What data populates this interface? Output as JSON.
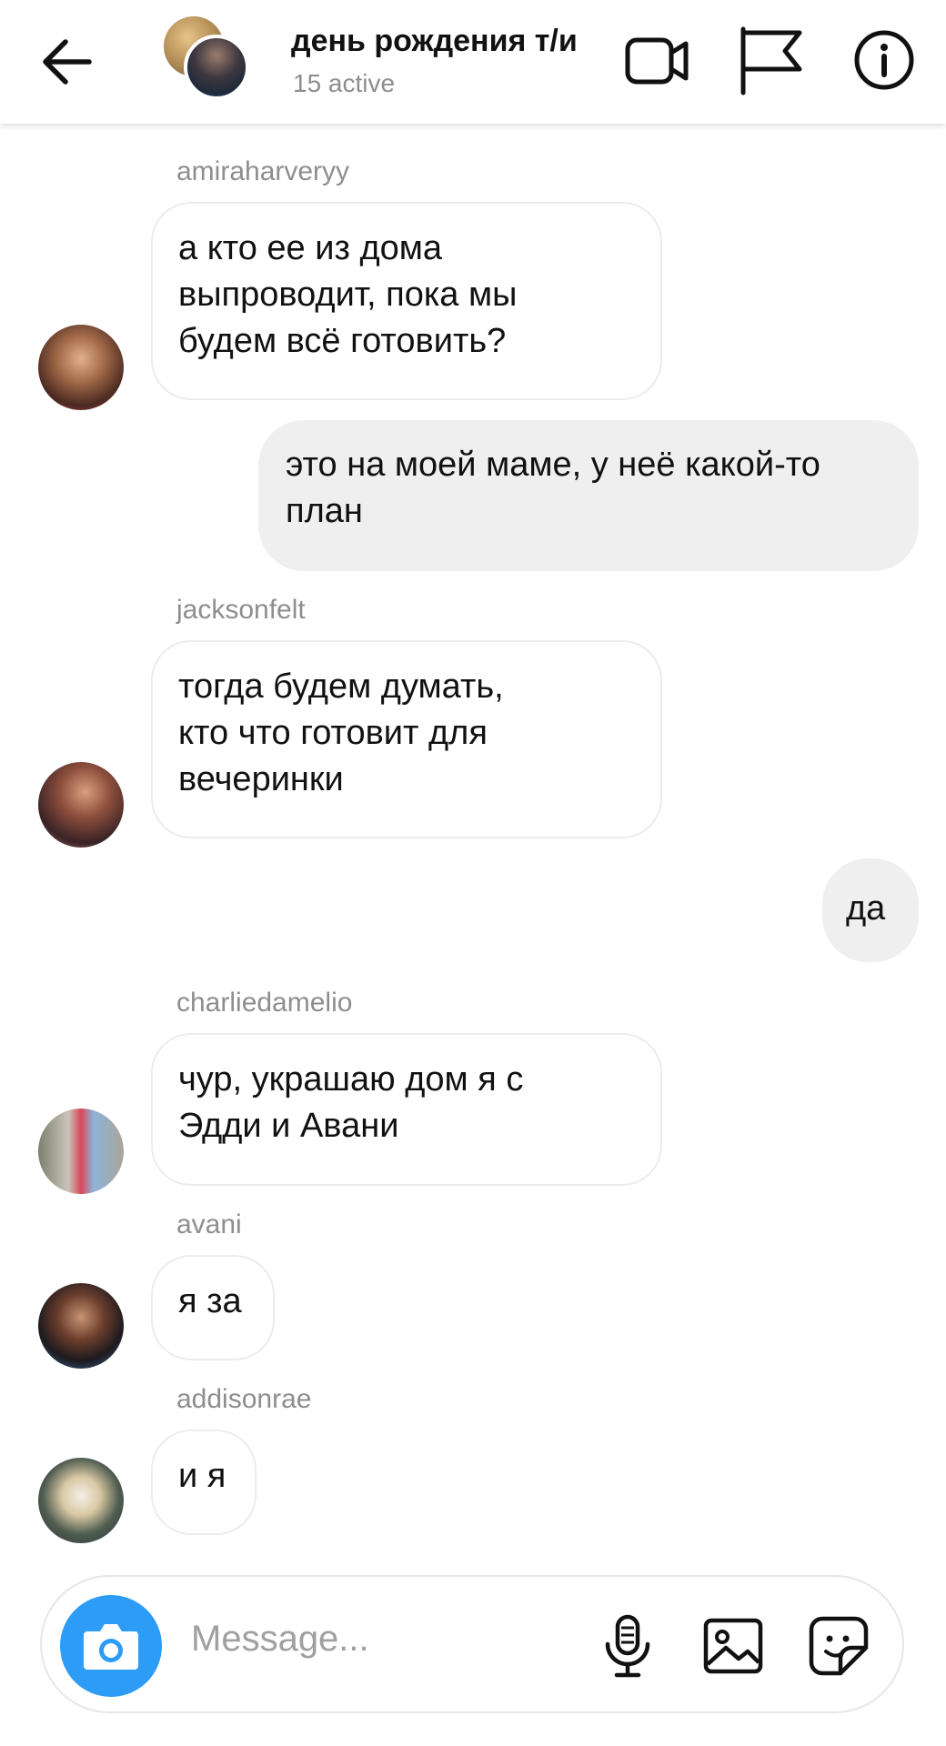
{
  "header": {
    "title": "день рождения т/и",
    "subtitle": "15 active"
  },
  "messages": [
    {
      "sender": "amiraharveryy",
      "lines": [
        "а кто ее из дома",
        "выпроводит, пока мы",
        "будем всё готовить?"
      ]
    },
    {
      "outgoing": true,
      "lines": [
        "это на моей маме, у неё какой-то",
        "план"
      ]
    },
    {
      "sender": "jacksonfelt",
      "lines": [
        "тогда будем думать,",
        "кто что готовит для",
        "вечеринки"
      ]
    },
    {
      "outgoing": true,
      "lines": [
        "да"
      ]
    },
    {
      "sender": "charliedamelio",
      "lines": [
        "чур, украшаю дом я с",
        "Эдди и Авани"
      ]
    },
    {
      "sender": "avani",
      "lines": [
        "я за"
      ]
    },
    {
      "sender": "addisonrae",
      "lines": [
        "и я"
      ]
    }
  ],
  "composer": {
    "placeholder": "Message..."
  },
  "icons": {
    "back": "arrow-left-icon",
    "video": "video-camera-icon",
    "flag": "flag-icon",
    "info": "info-icon",
    "camera": "camera-icon",
    "mic": "microphone-icon",
    "gallery": "image-icon",
    "sticker": "sticker-icon"
  },
  "colors": {
    "accent": "#2d9cf6",
    "outgoing_bubble": "#efefef",
    "secondary_text": "#8e8e8e"
  }
}
